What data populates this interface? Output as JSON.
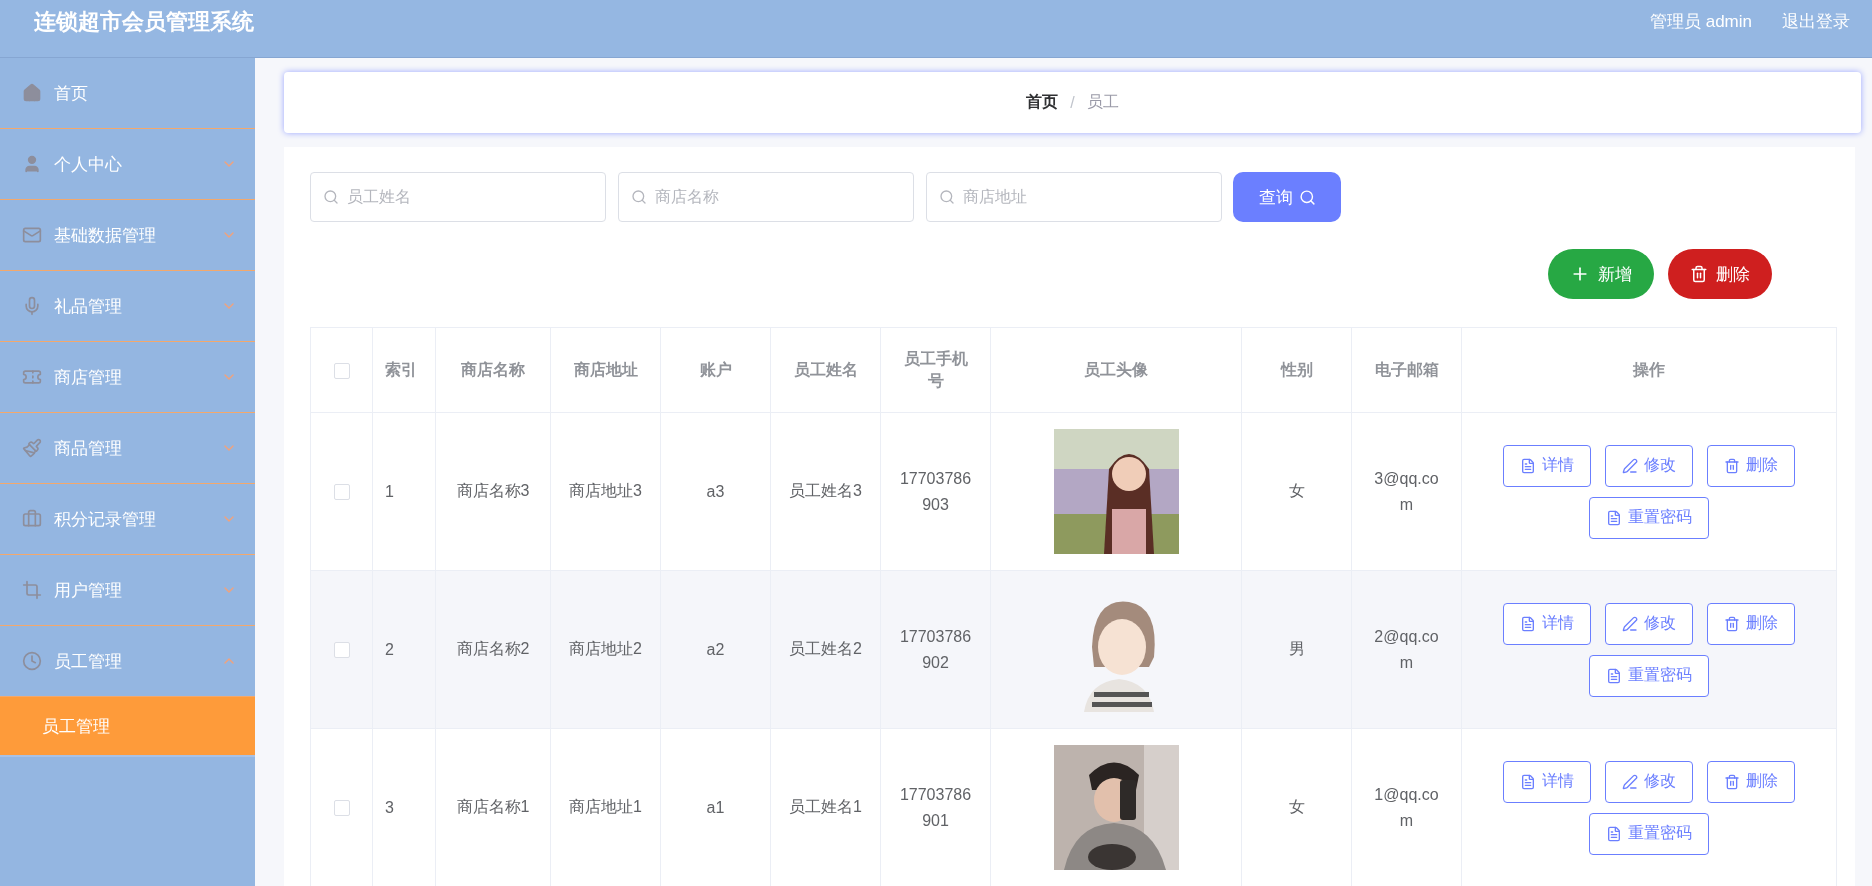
{
  "header": {
    "title": "连锁超市会员管理系统",
    "user": "管理员 admin",
    "logout": "退出登录"
  },
  "sidebar": {
    "items": [
      {
        "label": "首页",
        "kind": "link"
      },
      {
        "label": "个人中心",
        "kind": "menu",
        "expanded": false
      },
      {
        "label": "基础数据管理",
        "kind": "menu",
        "expanded": false
      },
      {
        "label": "礼品管理",
        "kind": "menu",
        "expanded": false
      },
      {
        "label": "商店管理",
        "kind": "menu",
        "expanded": false
      },
      {
        "label": "商品管理",
        "kind": "menu",
        "expanded": false
      },
      {
        "label": "积分记录管理",
        "kind": "menu",
        "expanded": false
      },
      {
        "label": "用户管理",
        "kind": "menu",
        "expanded": false
      },
      {
        "label": "员工管理",
        "kind": "menu",
        "expanded": true,
        "children": [
          {
            "label": "员工管理",
            "selected": true
          }
        ]
      }
    ]
  },
  "breadcrumb": {
    "separator": "/",
    "items": [
      {
        "label": "首页",
        "current": false
      },
      {
        "label": "员工",
        "current": true
      }
    ]
  },
  "search": {
    "fields": [
      {
        "placeholder": "员工姓名"
      },
      {
        "placeholder": "商店名称"
      },
      {
        "placeholder": "商店地址"
      }
    ],
    "button": "查询"
  },
  "actions": [
    {
      "label": "新增",
      "kind": "add"
    },
    {
      "label": "删除",
      "kind": "delete"
    }
  ],
  "table": {
    "select_all_checked": false,
    "columns": [
      "索引",
      "商店名称",
      "商店地址",
      "账户",
      "员工姓名",
      "员工手机号",
      "员工头像",
      "性别",
      "电子邮箱",
      "操作"
    ],
    "rows": [
      {
        "checked": false,
        "cells": [
          "1",
          "商店名称3",
          "商店地址3",
          "a3",
          "员工姓名3",
          "17703786903"
        ],
        "gender": "女",
        "email": "3@qq.com",
        "actions": [
          {
            "label": "详情",
            "kind": "detail"
          },
          {
            "label": "修改",
            "kind": "edit"
          },
          {
            "label": "删除",
            "kind": "delete"
          },
          {
            "label": "重置密码",
            "kind": "reset"
          }
        ]
      },
      {
        "checked": false,
        "cells": [
          "2",
          "商店名称2",
          "商店地址2",
          "a2",
          "员工姓名2",
          "17703786902"
        ],
        "gender": "男",
        "email": "2@qq.com",
        "actions": [
          {
            "label": "详情",
            "kind": "detail"
          },
          {
            "label": "修改",
            "kind": "edit"
          },
          {
            "label": "删除",
            "kind": "delete"
          },
          {
            "label": "重置密码",
            "kind": "reset"
          }
        ]
      },
      {
        "checked": false,
        "cells": [
          "3",
          "商店名称1",
          "商店地址1",
          "a1",
          "员工姓名1",
          "17703786901"
        ],
        "gender": "女",
        "email": "1@qq.com",
        "actions": [
          {
            "label": "详情",
            "kind": "detail"
          },
          {
            "label": "修改",
            "kind": "edit"
          },
          {
            "label": "删除",
            "kind": "delete"
          },
          {
            "label": "重置密码",
            "kind": "reset"
          }
        ]
      }
    ]
  }
}
